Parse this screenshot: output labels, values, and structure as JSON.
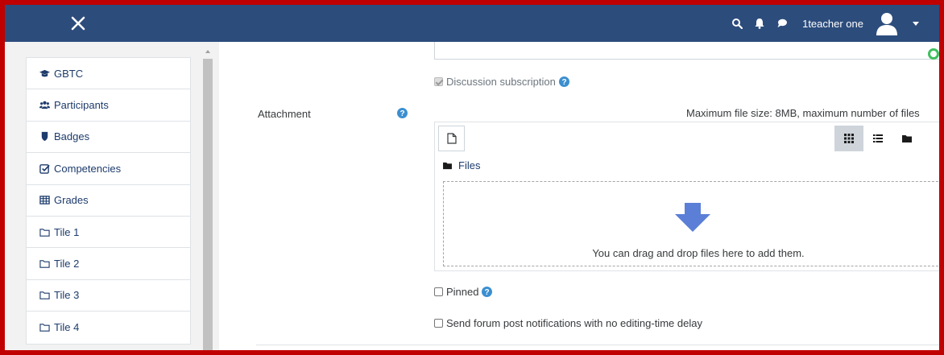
{
  "navbar": {
    "user_name": "1teacher one",
    "color": "#2c4c7c"
  },
  "drawer": {
    "items": [
      {
        "label": "GBTC",
        "icon": "graduation-cap-icon"
      },
      {
        "label": "Participants",
        "icon": "users-icon"
      },
      {
        "label": "Badges",
        "icon": "shield-icon"
      },
      {
        "label": "Competencies",
        "icon": "check-square-icon"
      },
      {
        "label": "Grades",
        "icon": "table-icon"
      },
      {
        "label": "Tile 1",
        "icon": "folder-icon"
      },
      {
        "label": "Tile 2",
        "icon": "folder-icon"
      },
      {
        "label": "Tile 3",
        "icon": "folder-icon"
      },
      {
        "label": "Tile 4",
        "icon": "folder-icon"
      }
    ]
  },
  "form": {
    "discussion_subscription": "Discussion subscription",
    "attachment_label": "Attachment",
    "max_file_size": "Maximum file size: 8MB, maximum number of files",
    "files_label": "Files",
    "drop_text": "You can drag and drop files here to add them.",
    "pinned_label": "Pinned",
    "no_delay_label": "Send forum post notifications with no editing-time delay"
  },
  "colors": {
    "frame": "#c00000",
    "link": "#1d3b6b",
    "help": "#3b8fd0",
    "arrow": "#5b7fd6"
  }
}
